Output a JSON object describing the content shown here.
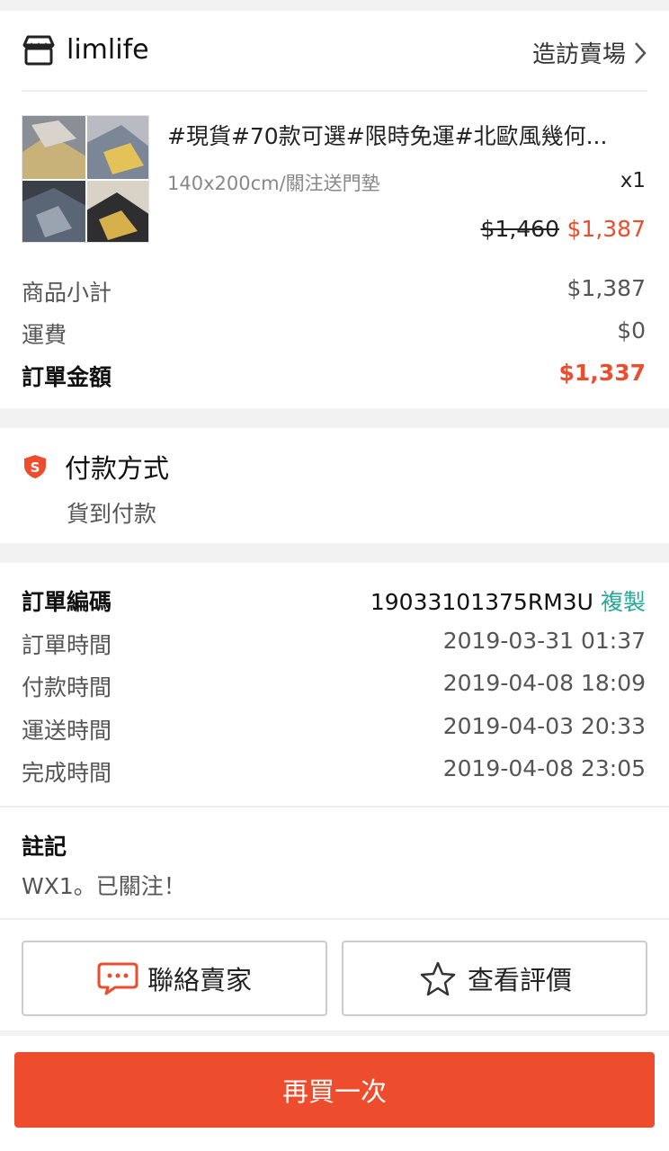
{
  "shop": {
    "name": "limlife",
    "visit_label": "造訪賣場"
  },
  "product": {
    "title": "#現貨#70款可選#限時免運#北歐風幾何...",
    "variation": "140x200cm/關注送門墊",
    "quantity": "x1",
    "original_price": "$1,460",
    "price": "$1,387"
  },
  "summary": {
    "subtotal_label": "商品小計",
    "subtotal_value": "$1,387",
    "shipping_label": "運費",
    "shipping_value": "$0",
    "total_label": "訂單金額",
    "total_value": "$1,337"
  },
  "payment": {
    "title": "付款方式",
    "method": "貨到付款"
  },
  "order_info": {
    "order_id_label": "訂單編碼",
    "order_id": "19033101375RM3U",
    "copy_label": "複製",
    "rows": [
      {
        "label": "訂單時間",
        "value": "2019-03-31 01:37"
      },
      {
        "label": "付款時間",
        "value": "2019-04-08 18:09"
      },
      {
        "label": "運送時間",
        "value": "2019-04-03 20:33"
      },
      {
        "label": "完成時間",
        "value": "2019-04-08 23:05"
      }
    ]
  },
  "note": {
    "title": "註記",
    "text": "WX1。已關注！"
  },
  "actions": {
    "contact_seller": "聯絡賣家",
    "view_rating": "查看評價",
    "buy_again": "再買一次"
  },
  "colors": {
    "accent": "#ee4d2d",
    "copy_link": "#26aa99"
  }
}
